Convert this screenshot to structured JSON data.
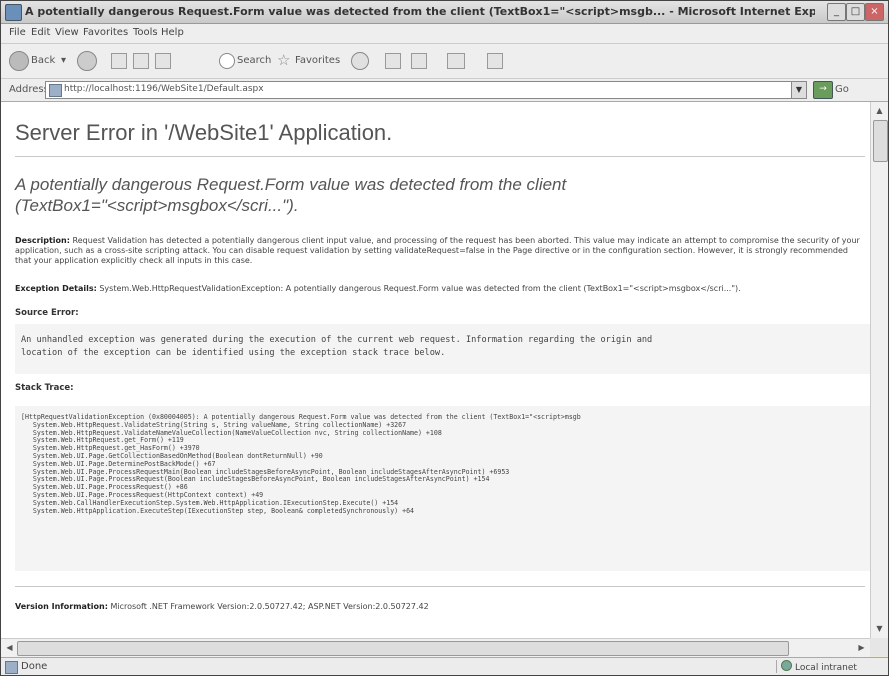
{
  "window": {
    "title": "A potentially dangerous Request.Form value was detected from the client (TextBox1=\"<script>msgb... - Microsoft Internet Explorer"
  },
  "menu": [
    "File",
    "Edit",
    "View",
    "Favorites",
    "Tools",
    "Help"
  ],
  "toolbar": {
    "back": "Back",
    "search": "Search",
    "favorites": "Favorites"
  },
  "address": {
    "label": "Address",
    "url": "http://localhost:1196/WebSite1/Default.aspx",
    "go": "Go"
  },
  "page": {
    "heading": "Server Error in '/WebSite1' Application.",
    "error_line1": "A potentially dangerous Request.Form value was detected from the client",
    "error_line2": "(TextBox1=\"<script>msgbox</scri...\").",
    "description_label": "Description:",
    "description_text": "Request Validation has detected a potentially dangerous client input value, and processing of the request has been aborted. This value may indicate an attempt to compromise the security of your application, such as a cross-site scripting attack. You can disable request validation by setting validateRequest=false in the Page directive or in the configuration section. However, it is strongly recommended that your application explicitly check all inputs in this case.",
    "exception_label": "Exception Details:",
    "exception_text": "System.Web.HttpRequestValidationException: A potentially dangerous Request.Form value was detected from the client (TextBox1=\"<script>msgbox</scri...\").",
    "source_label": "Source Error:",
    "source_text": "An unhandled exception was generated during the execution of the current web request. Information regarding the origin and\nlocation of the exception can be identified using the exception stack trace below.",
    "stack_label": "Stack Trace:",
    "stack_text": "[HttpRequestValidationException (0x80004005): A potentially dangerous Request.Form value was detected from the client (TextBox1=\"<script>msgb\n   System.Web.HttpRequest.ValidateString(String s, String valueName, String collectionName) +3267\n   System.Web.HttpRequest.ValidateNameValueCollection(NameValueCollection nvc, String collectionName) +108\n   System.Web.HttpRequest.get_Form() +119\n   System.Web.HttpRequest.get_HasForm() +3970\n   System.Web.UI.Page.GetCollectionBasedOnMethod(Boolean dontReturnNull) +90\n   System.Web.UI.Page.DeterminePostBackMode() +67\n   System.Web.UI.Page.ProcessRequestMain(Boolean includeStagesBeforeAsyncPoint, Boolean includeStagesAfterAsyncPoint) +6953\n   System.Web.UI.Page.ProcessRequest(Boolean includeStagesBeforeAsyncPoint, Boolean includeStagesAfterAsyncPoint) +154\n   System.Web.UI.Page.ProcessRequest() +86\n   System.Web.UI.Page.ProcessRequest(HttpContext context) +49\n   System.Web.CallHandlerExecutionStep.System.Web.HttpApplication.IExecutionStep.Execute() +154\n   System.Web.HttpApplication.ExecuteStep(IExecutionStep step, Boolean& completedSynchronously) +64",
    "version_label": "Version Information:",
    "version_text": "Microsoft .NET Framework Version:2.0.50727.42; ASP.NET Version:2.0.50727.42"
  },
  "status": {
    "text": "Done",
    "zone": "Local intranet"
  }
}
